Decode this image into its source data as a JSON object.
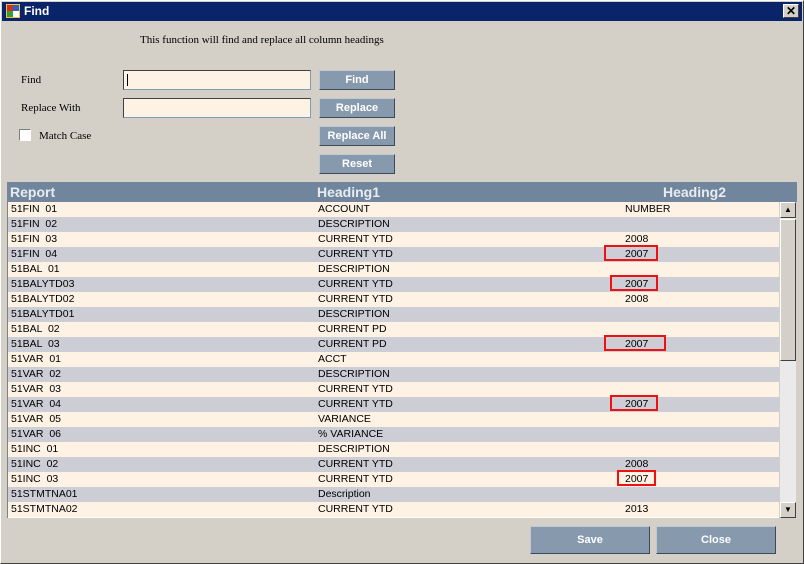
{
  "window": {
    "title": "Find",
    "close_glyph": "✕"
  },
  "description": "This function will find and replace all column headings",
  "find": {
    "label": "Find",
    "value": "",
    "button": "Find"
  },
  "replace": {
    "label": "Replace With",
    "value": "",
    "button": "Replace"
  },
  "match_case": {
    "label": "Match Case",
    "checked": false
  },
  "replace_all_button": "Replace All",
  "reset_button": "Reset",
  "grid": {
    "columns": [
      "Report",
      "Heading1",
      "Heading2"
    ],
    "rows": [
      {
        "report": "51FIN  01",
        "h1": "ACCOUNT",
        "h2": "NUMBER"
      },
      {
        "report": "51FIN  02",
        "h1": "DESCRIPTION",
        "h2": ""
      },
      {
        "report": "51FIN  03",
        "h1": "CURRENT YTD",
        "h2": "2008"
      },
      {
        "report": "51FIN  04",
        "h1": "CURRENT YTD",
        "h2": "2007"
      },
      {
        "report": "51BAL  01",
        "h1": "DESCRIPTION",
        "h2": ""
      },
      {
        "report": "51BALYTD03",
        "h1": "CURRENT YTD",
        "h2": "2007"
      },
      {
        "report": "51BALYTD02",
        "h1": "CURRENT YTD",
        "h2": "2008"
      },
      {
        "report": "51BALYTD01",
        "h1": "DESCRIPTION",
        "h2": ""
      },
      {
        "report": "51BAL  02",
        "h1": "CURRENT PD",
        "h2": ""
      },
      {
        "report": "51BAL  03",
        "h1": "CURRENT PD",
        "h2": "2007"
      },
      {
        "report": "51VAR  01",
        "h1": "ACCT",
        "h2": ""
      },
      {
        "report": "51VAR  02",
        "h1": "DESCRIPTION",
        "h2": ""
      },
      {
        "report": "51VAR  03",
        "h1": "CURRENT YTD",
        "h2": ""
      },
      {
        "report": "51VAR  04",
        "h1": "CURRENT YTD",
        "h2": "2007"
      },
      {
        "report": "51VAR  05",
        "h1": "VARIANCE",
        "h2": ""
      },
      {
        "report": "51VAR  06",
        "h1": "% VARIANCE",
        "h2": ""
      },
      {
        "report": "51INC  01",
        "h1": "DESCRIPTION",
        "h2": ""
      },
      {
        "report": "51INC  02",
        "h1": "CURRENT YTD",
        "h2": "2008"
      },
      {
        "report": "51INC  03",
        "h1": "CURRENT YTD",
        "h2": "2007"
      },
      {
        "report": "51STMTNA01",
        "h1": "Description",
        "h2": ""
      },
      {
        "report": "51STMTNA02",
        "h1": "CURRENT YTD",
        "h2": "2013"
      }
    ]
  },
  "scrollbar": {
    "up_icon": "▲",
    "down_icon": "▼"
  },
  "save_button": "Save",
  "close_button": "Close",
  "colors": {
    "title_bar": "#0a246a",
    "button": "#8699ad",
    "header": "#71869d",
    "row_light": "#fdf2e4",
    "row_dark": "#cdcdd6",
    "highlight": "#ee1111"
  }
}
